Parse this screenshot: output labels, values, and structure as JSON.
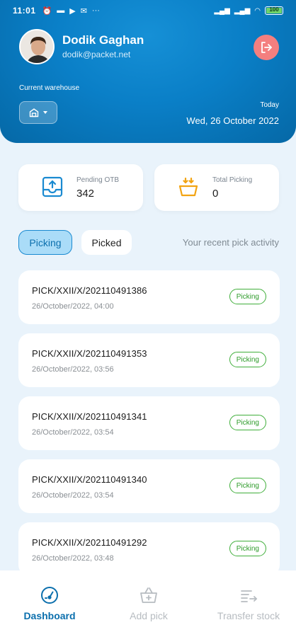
{
  "status_bar": {
    "time": "11:01",
    "battery": "100"
  },
  "user": {
    "name": "Dodik Gaghan",
    "email": "dodik@packet.net"
  },
  "warehouse": {
    "label": "Current warehouse"
  },
  "today": {
    "label": "Today",
    "date": "Wed, 26 October 2022"
  },
  "stats": {
    "pending_otb": {
      "label": "Pending OTB",
      "value": "342"
    },
    "total_picking": {
      "label": "Total Picking",
      "value": "0"
    }
  },
  "tabs": [
    {
      "label": "Picking",
      "active": true
    },
    {
      "label": "Picked",
      "active": false
    }
  ],
  "recent_label": "Your recent pick activity",
  "picks": [
    {
      "code": "PICK/XXII/X/202110491386",
      "date": "26/October/2022, 04:00",
      "status": "Picking"
    },
    {
      "code": "PICK/XXII/X/202110491353",
      "date": "26/October/2022, 03:56",
      "status": "Picking"
    },
    {
      "code": "PICK/XXII/X/202110491341",
      "date": "26/October/2022, 03:54",
      "status": "Picking"
    },
    {
      "code": "PICK/XXII/X/202110491340",
      "date": "26/October/2022, 03:54",
      "status": "Picking"
    },
    {
      "code": "PICK/XXII/X/202110491292",
      "date": "26/October/2022, 03:48",
      "status": "Picking"
    }
  ],
  "nav": [
    {
      "label": "Dashboard",
      "icon": "gauge-icon",
      "active": true
    },
    {
      "label": "Add pick",
      "icon": "basket-add-icon",
      "active": false
    },
    {
      "label": "Transfer stock",
      "icon": "transfer-icon",
      "active": false
    }
  ],
  "colors": {
    "primary": "#0a7fc7",
    "accent_light": "#aadcf8",
    "success": "#3fae3a",
    "logout": "#f47f7f",
    "background": "#e9f3fb"
  }
}
